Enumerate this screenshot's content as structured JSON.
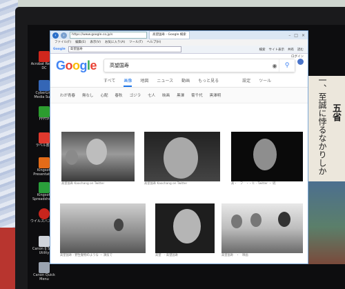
{
  "desktop_icons": [
    {
      "label": "Acrobat Reader DC",
      "color": "#d0271d"
    },
    {
      "label": "CyberLink Media Suite",
      "color": "#3466b6"
    },
    {
      "label": "FFFTP",
      "color": "#2c9c2f"
    },
    {
      "label": "ラベル書き",
      "color": "#e0392e"
    },
    {
      "label": "Kingsoft Presentation",
      "color": "#e36b18"
    },
    {
      "label": "Kingsoft Spreadsheets",
      "color": "#2a9f3b"
    },
    {
      "label": "ウイルスバスター",
      "color": "#c8251d"
    },
    {
      "label": "Canon IJ Scan Utility",
      "color": "#cfd3da"
    },
    {
      "label": "Canon Quick Menu",
      "color": "#9aa3b0"
    }
  ],
  "browser": {
    "url": "https://www.google.co.jp/s",
    "tab_title": "高望国寿 - Google 検索",
    "menu": [
      "ファイル(F)",
      "編集(E)",
      "表示(V)",
      "お気に入り(A)",
      "ツール(T)",
      "ヘルプ(H)"
    ],
    "toolbar_search_value": "高望国寿",
    "toolbar_search_logo": "Google",
    "toolbar_right": [
      "検索",
      "サイト表示",
      "共有",
      "読む"
    ],
    "window_controls": [
      "–",
      "□",
      "×"
    ]
  },
  "google": {
    "logo_letters": [
      {
        "ch": "G",
        "color": "#4285f4"
      },
      {
        "ch": "o",
        "color": "#ea4335"
      },
      {
        "ch": "o",
        "color": "#fbbc05"
      },
      {
        "ch": "g",
        "color": "#4285f4"
      },
      {
        "ch": "l",
        "color": "#34a853"
      },
      {
        "ch": "e",
        "color": "#ea4335"
      }
    ],
    "query": "高望国寿",
    "login": "ログイン",
    "tabs": [
      "すべて",
      "画像",
      "地図",
      "ニュース",
      "動画",
      "もっと見る"
    ],
    "active_tab": "画像",
    "tabs_right": [
      "設定",
      "ツール"
    ],
    "chips": [
      "わが青春",
      "無なし",
      "心配",
      "春秋",
      "ゴジラ",
      "七人",
      "映画",
      "黒澤",
      "菊千代",
      "黒澤明"
    ],
    "results_row1": [
      {
        "caption": "高望国寿 Kaochang on Twitter"
      },
      {
        "caption": "高望国寿 Kaochang on Twitter"
      },
      {
        "caption": "高・　フ　・・ヒ - Twitter ・ 続"
      }
    ],
    "results_row2": [
      {
        "caption": "高望国寿 - 野生動物のような ・ 演技で"
      },
      {
        "caption": "高望　- 高望国寿"
      },
      {
        "caption": "高望国寿　・　映画"
      }
    ]
  },
  "wallpaper_text": [
    "五省",
    "一、至誠に悖るなかりしか"
  ]
}
